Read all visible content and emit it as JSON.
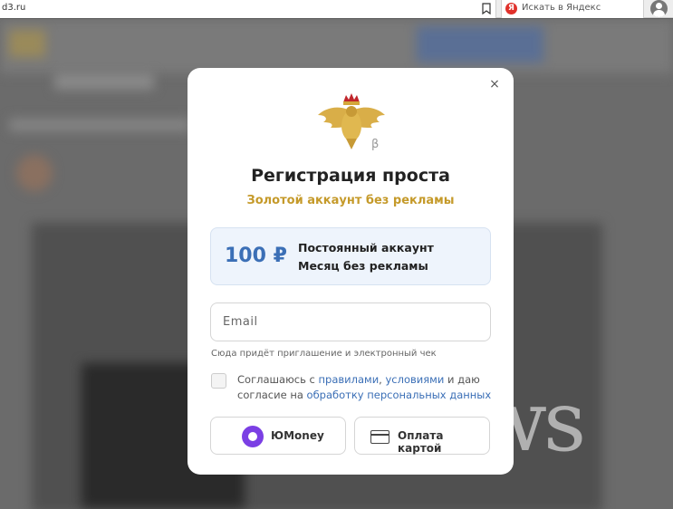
{
  "browser": {
    "url": "d3.ru",
    "search_placeholder": "Искать в Яндекс",
    "search_engine_letter": "Я"
  },
  "watermark": "cnews",
  "modal": {
    "close_symbol": "×",
    "logo_beta": "β",
    "title": "Регистрация проста",
    "subtitle": "Золотой аккаунт без рекламы",
    "plan": {
      "price": "100 ₽",
      "line1": "Постоянный аккаунт",
      "line2": "Месяц без рекламы"
    },
    "email_placeholder": "Email",
    "email_hint": "Сюда придёт приглашение и электронный чек",
    "consent": {
      "text_before": "Соглашаюсь с ",
      "link_rules": "правилами",
      "sep": ", ",
      "link_terms": "условиями",
      "text_middle": " и даю согласие на ",
      "link_data": "обработку персональных данных",
      "checked": false
    },
    "payment": {
      "yoomoney_label": "ЮMoney",
      "card_label": "Оплата картой"
    }
  },
  "colors": {
    "accent_gold": "#c59a2a",
    "price_blue": "#3b6fb6",
    "yoomoney_purple": "#7b3fe4"
  }
}
